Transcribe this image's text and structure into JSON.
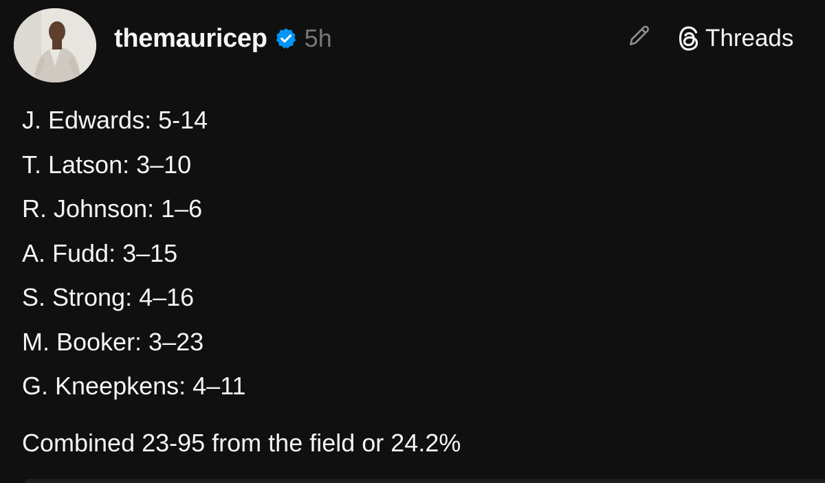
{
  "post": {
    "author": {
      "username": "themauricep",
      "verified": true,
      "timestamp": "5h"
    },
    "actions": {
      "edit_icon": "pencil-icon",
      "threads_label": "Threads",
      "threads_icon": "threads-logo-icon"
    },
    "lines": [
      "J. Edwards: 5-14",
      "T. Latson: 3–10",
      "R. Johnson: 1–6",
      "A. Fudd: 3–15",
      "S. Strong: 4–16",
      "M. Booker: 3–23",
      "G. Kneepkens: 4–11"
    ],
    "summary": "Combined 23-95 from the field or 24.2%"
  },
  "colors": {
    "background": "#101010",
    "text": "#f3f5f7",
    "muted": "#777777",
    "verified_badge": "#0095f6"
  }
}
